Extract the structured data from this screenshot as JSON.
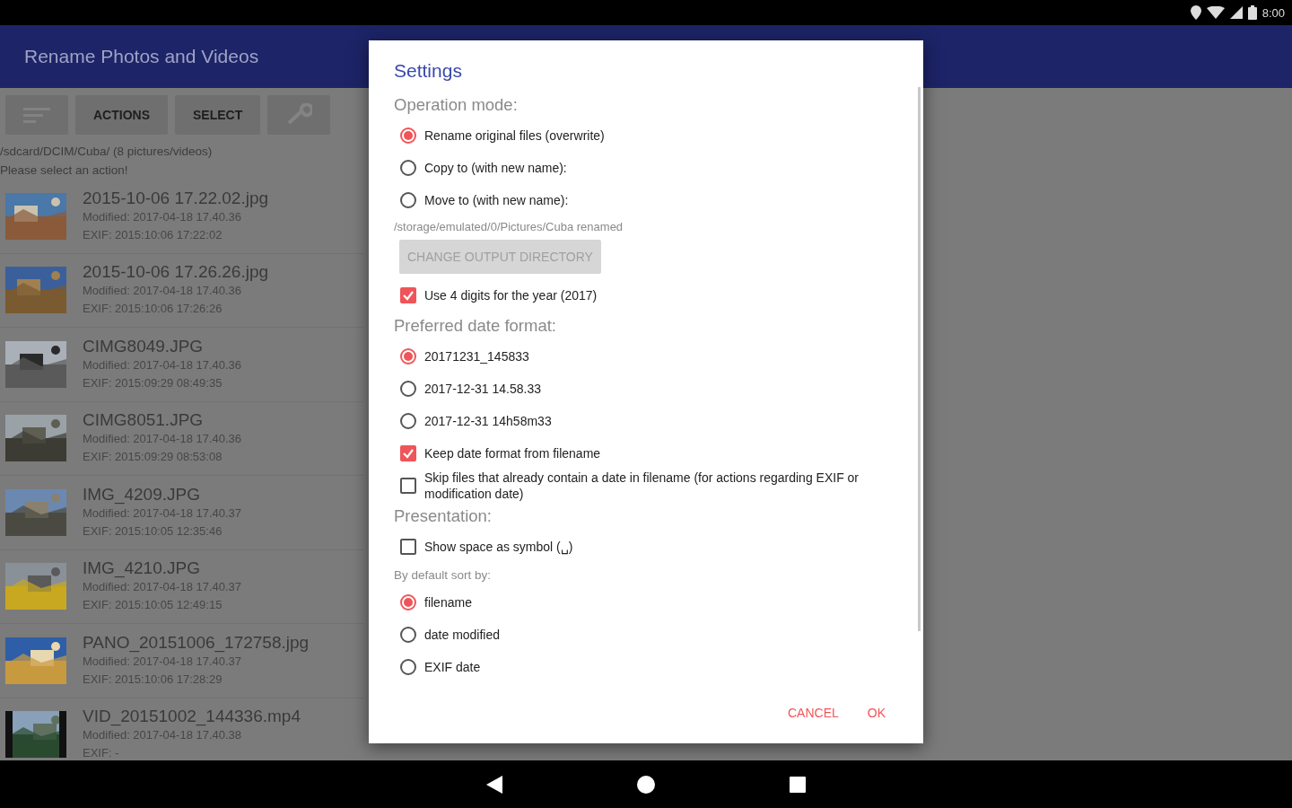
{
  "status_bar": {
    "time": "8:00"
  },
  "app_bar": {
    "title": "Rename Photos and Videos"
  },
  "toolbar": [
    {
      "kind": "icon"
    },
    {
      "kind": "text",
      "label": "ACTIONS"
    },
    {
      "kind": "text",
      "label": "SELECT"
    },
    {
      "kind": "wrench"
    }
  ],
  "folder": "/sdcard/DCIM/Cuba/ (8 pictures/videos)",
  "hint": "Please select an action!",
  "files": [
    {
      "name": "2015-10-06 17.22.02.jpg",
      "modified": "Modified: 2017-04-18 17.40.36",
      "exif": "EXIF: 2015:10:06 17:22:02"
    },
    {
      "name": "2015-10-06 17.26.26.jpg",
      "modified": "Modified: 2017-04-18 17.40.36",
      "exif": "EXIF: 2015:10:06 17:26:26"
    },
    {
      "name": "CIMG8049.JPG",
      "modified": "Modified: 2017-04-18 17.40.36",
      "exif": "EXIF: 2015:09:29 08:49:35"
    },
    {
      "name": "CIMG8051.JPG",
      "modified": "Modified: 2017-04-18 17.40.36",
      "exif": "EXIF: 2015:09:29 08:53:08"
    },
    {
      "name": "IMG_4209.JPG",
      "modified": "Modified: 2017-04-18 17.40.37",
      "exif": "EXIF: 2015:10:05 12:35:46"
    },
    {
      "name": "IMG_4210.JPG",
      "modified": "Modified: 2017-04-18 17.40.37",
      "exif": "EXIF: 2015:10:05 12:49:15"
    },
    {
      "name": "PANO_20151006_172758.jpg",
      "modified": "Modified: 2017-04-18 17.40.37",
      "exif": "EXIF: 2015:10:06 17:28:29"
    },
    {
      "name": "VID_20151002_144336.mp4",
      "modified": "Modified: 2017-04-18 17.40.38",
      "exif": "EXIF: -",
      "kind": "video"
    }
  ],
  "dialog": {
    "title": "Settings",
    "items": [
      {
        "kind": "section",
        "text": "Operation mode:"
      },
      {
        "kind": "radio",
        "text": "Rename original files (overwrite)",
        "selected": true
      },
      {
        "kind": "radio",
        "text": "Copy to (with new name):",
        "selected": false
      },
      {
        "kind": "radio",
        "text": "Move to (with new name):",
        "selected": false
      },
      {
        "kind": "path",
        "text": "/storage/emulated/0/Pictures/Cuba renamed"
      },
      {
        "kind": "button",
        "text": "CHANGE OUTPUT DIRECTORY",
        "disabled": true
      },
      {
        "kind": "checkbox",
        "text": "Use 4 digits for the year (2017)",
        "checked": true
      },
      {
        "kind": "section",
        "text": "Preferred date format:"
      },
      {
        "kind": "radio",
        "text": "20171231_145833",
        "selected": true
      },
      {
        "kind": "radio",
        "text": "2017-12-31 14.58.33",
        "selected": false
      },
      {
        "kind": "radio",
        "text": "2017-12-31 14h58m33",
        "selected": false
      },
      {
        "kind": "checkbox",
        "text": "Keep date format from filename",
        "checked": true
      },
      {
        "kind": "checkbox",
        "text": "Skip files that already contain a date in filename (for actions regarding EXIF or modification date)",
        "checked": false
      },
      {
        "kind": "section",
        "text": "Presentation:"
      },
      {
        "kind": "checkbox",
        "text": "Show space as symbol (␣)",
        "checked": false
      },
      {
        "kind": "sublabel",
        "text": "By default sort by:"
      },
      {
        "kind": "radio",
        "text": "filename",
        "selected": true
      },
      {
        "kind": "radio",
        "text": "date modified",
        "selected": false
      },
      {
        "kind": "radio",
        "text": "EXIF date",
        "selected": false
      }
    ],
    "actions": [
      "CANCEL",
      "OK"
    ]
  }
}
